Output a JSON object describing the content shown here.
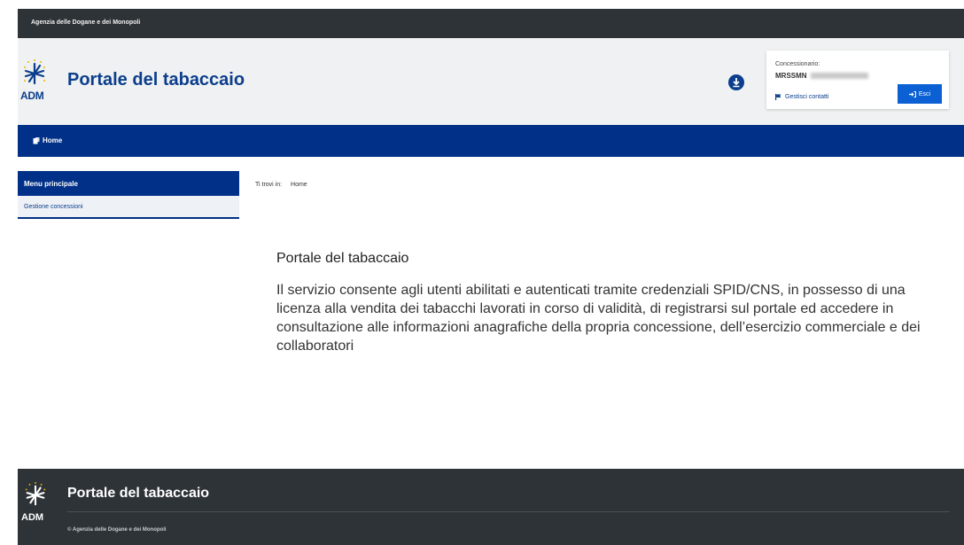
{
  "topbar": {
    "agency": "Agenzia delle Dogane e dei Monopoli"
  },
  "header": {
    "logo_text": "ADM",
    "site_title": "Portale del tabaccaio",
    "user": {
      "label": "Concessionario:",
      "code": "MRSSMN",
      "contacts_link": "Gestisci contatti",
      "exit_button": "Esci"
    }
  },
  "navbar": {
    "home": "Home"
  },
  "sidebar": {
    "title": "Menu principale",
    "items": [
      {
        "label": "Gestione concessioni"
      }
    ]
  },
  "breadcrumb": {
    "prefix": "Ti trovi in:",
    "current": "Home"
  },
  "main": {
    "title": "Portale del tabaccaio",
    "text": "Il servizio consente agli utenti abilitati e autenticati tramite credenziali SPID/CNS, in possesso di una licenza alla vendita dei tabacchi lavorati in corso di validità, di registrarsi sul portale ed accedere in consultazione alle informazioni anagrafiche della propria concessione, dell’esercizio commerciale e dei collaboratori"
  },
  "footer": {
    "logo_text": "ADM",
    "title": "Portale del tabaccaio",
    "copyright": "© Agenzia delle Dogane e dei Monopoli"
  },
  "icons": {
    "logo": "adm-star-logo-icon",
    "download": "download-circle-icon",
    "flag": "flag-icon",
    "exit": "sign-out-icon",
    "home": "home-icon"
  },
  "colors": {
    "brand_blue": "#003087",
    "title_blue": "#0b3e8c",
    "button_blue": "#0b60d4",
    "dark_bar": "#2e3338"
  }
}
